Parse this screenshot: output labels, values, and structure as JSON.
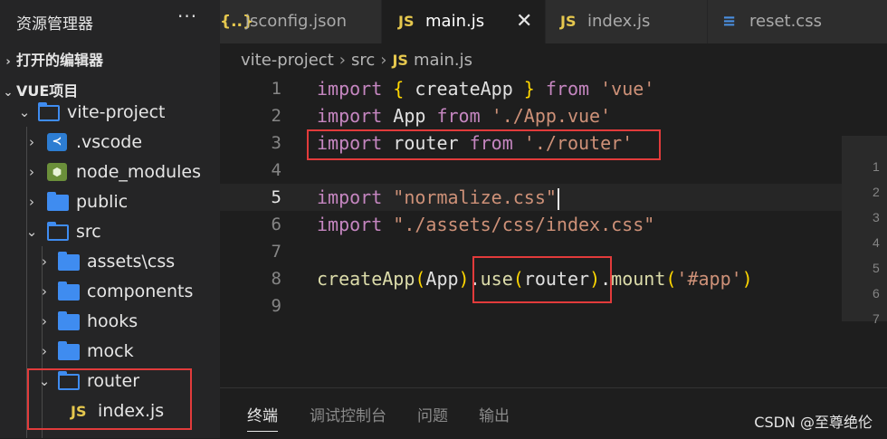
{
  "sidebar": {
    "title": "资源管理器",
    "more": "···",
    "open_editors": "打开的编辑器",
    "project": "VUE项目",
    "items": [
      {
        "label": "vite-project",
        "icon": "folder-open-icon"
      },
      {
        "label": ".vscode",
        "icon": "vscode-folder-icon"
      },
      {
        "label": "node_modules",
        "icon": "node-folder-icon"
      },
      {
        "label": "public",
        "icon": "folder-icon"
      },
      {
        "label": "src",
        "icon": "folder-open-icon"
      },
      {
        "label": "assets\\css",
        "icon": "folder-icon"
      },
      {
        "label": "components",
        "icon": "folder-icon"
      },
      {
        "label": "hooks",
        "icon": "folder-icon"
      },
      {
        "label": "mock",
        "icon": "folder-icon"
      },
      {
        "label": "router",
        "icon": "folder-open-icon"
      },
      {
        "label": "index.js",
        "icon": "js-file-icon"
      }
    ]
  },
  "tabs": [
    {
      "label": "jsconfig.json",
      "icon": "braces-icon"
    },
    {
      "label": "main.js",
      "icon": "js-file-icon",
      "active": true
    },
    {
      "label": "index.js",
      "icon": "js-file-icon"
    },
    {
      "label": "reset.css",
      "icon": "css-file-icon"
    }
  ],
  "breadcrumb": [
    "vite-project",
    "src",
    "main.js"
  ],
  "editor": {
    "line_numbers": [
      "1",
      "2",
      "3",
      "4",
      "5",
      "6",
      "7",
      "8",
      "9"
    ],
    "current_line": 5,
    "lines": [
      [
        {
          "t": "import",
          "c": "kw"
        },
        {
          "t": " ",
          "c": "plain"
        },
        {
          "t": "{",
          "c": "br1"
        },
        {
          "t": " createApp ",
          "c": "plain"
        },
        {
          "t": "}",
          "c": "br1"
        },
        {
          "t": " ",
          "c": "plain"
        },
        {
          "t": "from",
          "c": "kw"
        },
        {
          "t": " ",
          "c": "plain"
        },
        {
          "t": "'vue'",
          "c": "str"
        }
      ],
      [
        {
          "t": "import",
          "c": "kw"
        },
        {
          "t": " App ",
          "c": "plain"
        },
        {
          "t": "from",
          "c": "kw"
        },
        {
          "t": " ",
          "c": "plain"
        },
        {
          "t": "'./App.vue'",
          "c": "str"
        }
      ],
      [
        {
          "t": "import",
          "c": "kw"
        },
        {
          "t": " router ",
          "c": "plain"
        },
        {
          "t": "from",
          "c": "kw"
        },
        {
          "t": " ",
          "c": "plain"
        },
        {
          "t": "'./router'",
          "c": "str"
        }
      ],
      [],
      [
        {
          "t": "import",
          "c": "kw"
        },
        {
          "t": " ",
          "c": "plain"
        },
        {
          "t": "\"normalize.css\"",
          "c": "str"
        }
      ],
      [
        {
          "t": "import",
          "c": "kw"
        },
        {
          "t": " ",
          "c": "plain"
        },
        {
          "t": "\"./assets/css/index.css\"",
          "c": "str"
        }
      ],
      [],
      [
        {
          "t": "createApp",
          "c": "fn"
        },
        {
          "t": "(",
          "c": "br1"
        },
        {
          "t": "App",
          "c": "plain"
        },
        {
          "t": ")",
          "c": "br1"
        },
        {
          "t": ".",
          "c": "plain"
        },
        {
          "t": "use",
          "c": "fn"
        },
        {
          "t": "(",
          "c": "br1"
        },
        {
          "t": "router",
          "c": "plain"
        },
        {
          "t": ")",
          "c": "br1"
        },
        {
          "t": ".",
          "c": "plain"
        },
        {
          "t": "mount",
          "c": "fn"
        },
        {
          "t": "(",
          "c": "br1"
        },
        {
          "t": "'#app'",
          "c": "str"
        },
        {
          "t": ")",
          "c": "br1"
        }
      ],
      []
    ]
  },
  "minimap_numbers": [
    "1",
    "2",
    "3",
    "4",
    "5",
    "6",
    "7"
  ],
  "panel": {
    "tabs": [
      "终端",
      "调试控制台",
      "问题",
      "输出"
    ]
  },
  "watermark": "CSDN @至尊绝伦",
  "colors": {
    "highlight": "#e23b3b",
    "keyword": "#c586c0",
    "string": "#ce9178",
    "function": "#dcdcaa"
  }
}
